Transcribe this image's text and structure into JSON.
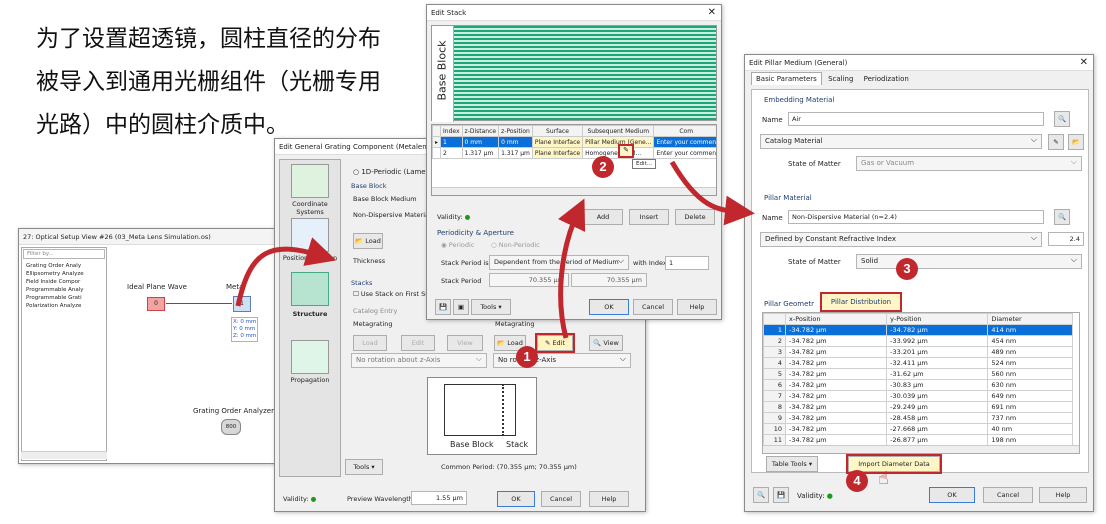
{
  "caption": "为了设置超透镜，圆柱直径的分布被导入到通用光栅组件（光栅专用光路）中的圆柱介质中。",
  "setup": {
    "title": "27: Optical Setup View #26 (03_Meta Lens Simulation.os)",
    "filter": "Filter by...",
    "tree": [
      "Grating Order Analy",
      "Ellipsometry Analyze",
      "Field Inside Compor",
      "Programmable Analy",
      "Programmable Grati",
      "Polarization Analyze"
    ],
    "wave_label": "Ideal Plane Wave",
    "wave_node": "0",
    "metalens_label": "Metal",
    "metalens_node": "1",
    "coords": [
      "X: 0 mm",
      "Y: 0 mm",
      "Z: 0 mm"
    ],
    "analyzer_label": "Grating Order Analyzer",
    "analyzer_node": "800"
  },
  "ggc": {
    "title": "Edit General Grating Component (Metalens)",
    "nav": [
      "Coordinate Systems",
      "Position / ...ation",
      "Structure",
      "Propagation"
    ],
    "lamellar": "1D-Periodic (Lamellar)",
    "base_block": "Base Block",
    "base_block_medium": "Base Block Medium",
    "medium_value": "Non-Dispersive Material (",
    "load": "Load",
    "thickness": "Thickness",
    "stacks": "Stacks",
    "use_stack": "Use Stack on First Surf",
    "catalog_entry": "Catalog Entry",
    "metagrating": "Metagrating",
    "metagrating2": "Metagrating",
    "load_dis": "Load",
    "edit_dis": "Edit",
    "view_dis": "View",
    "load2": "Load",
    "edit2": "Edit",
    "view2": "View",
    "rotation": "No rotation about z-Axis",
    "rotation2": "No rota   ut z-Axis",
    "diagram_base": "Base Block",
    "diagram_stack": "Stack",
    "tools": "Tools",
    "common_period": "Common Period: (70.355 µm; 70.355 µm)",
    "validity": "Validity:",
    "preview_wl": "Preview Wavelength",
    "preview_wl_val": "1.55 µm",
    "ok": "OK",
    "cancel": "Cancel",
    "help": "Help"
  },
  "stack": {
    "title": "Edit Stack",
    "base_block": "Base Block",
    "headers": [
      "Index",
      "z-Distance",
      "z-Position",
      "Surface",
      "Subsequent Medium",
      "Com"
    ],
    "rows": [
      [
        "1",
        "0 mm",
        "0 mm",
        "Plane Interface",
        "Pillar Medium (Gene...",
        "Enter your commen"
      ],
      [
        "2",
        "1.317 µm",
        "1.317 µm",
        "Plane Interface",
        "Homogeneous M...",
        "Enter your commen"
      ]
    ],
    "edit_tip": "Edit...",
    "validity": "Validity:",
    "add": "Add",
    "insert": "Insert",
    "delete": "Delete",
    "periodicity": "Periodicity & Aperture",
    "periodic": "Periodic",
    "nonperiodic": "Non-Periodic",
    "stack_period_is": "Stack Period is",
    "stack_period_mode": "Dependent from the Period of Medium",
    "with_index": "with Index",
    "index_val": "1",
    "stack_period": "Stack Period",
    "period_x": "70.355 µm",
    "period_y": "70.355 µm",
    "tools": "Tools",
    "ok": "OK",
    "cancel": "Cancel",
    "help": "Help"
  },
  "pillar": {
    "title": "Edit Pillar Medium (General)",
    "tabs": [
      "Basic Parameters",
      "Scaling",
      "Periodization"
    ],
    "embedding": "Embedding Material",
    "name_lbl": "Name",
    "name_air": "Air",
    "catalog": "Catalog Material",
    "state_lbl": "State of Matter",
    "state_gas": "Gas or Vacuum",
    "pillar_material": "Pillar Material",
    "name_pillar": "Non-Dispersive Material (n=2.4)",
    "defined_by": "Defined by Constant Refractive Index",
    "n_val": "2.4",
    "state_solid": "Solid",
    "geometry": "Pillar Geometr",
    "distribution": "Pillar Distribution",
    "headers": [
      "x-Position",
      "y-Position",
      "Diameter"
    ],
    "rows": [
      [
        "1",
        "-34.782 µm",
        "-34.782 µm",
        "414 nm"
      ],
      [
        "2",
        "-34.782 µm",
        "-33.992 µm",
        "454 nm"
      ],
      [
        "3",
        "-34.782 µm",
        "-33.201 µm",
        "489 nm"
      ],
      [
        "4",
        "-34.782 µm",
        "-32.411 µm",
        "524 nm"
      ],
      [
        "5",
        "-34.782 µm",
        "-31.62 µm",
        "560 nm"
      ],
      [
        "6",
        "-34.782 µm",
        "-30.83 µm",
        "630 nm"
      ],
      [
        "7",
        "-34.782 µm",
        "-30.039 µm",
        "649 nm"
      ],
      [
        "8",
        "-34.782 µm",
        "-29.249 µm",
        "691 nm"
      ],
      [
        "9",
        "-34.782 µm",
        "-28.458 µm",
        "737 nm"
      ],
      [
        "10",
        "-34.782 µm",
        "-27.668 µm",
        "40 nm"
      ],
      [
        "11",
        "-34.782 µm",
        "-26.877 µm",
        "198 nm"
      ]
    ],
    "table_tools": "Table Tools",
    "import": "Import Diameter Data",
    "validity": "Validity:",
    "ok": "OK",
    "cancel": "Cancel",
    "help": "Help"
  },
  "badges": [
    "1",
    "2",
    "3",
    "4"
  ],
  "colors": {
    "highlight": "#c0282d",
    "selection": "#0a6fd8",
    "stripe": "#1fa57a"
  }
}
